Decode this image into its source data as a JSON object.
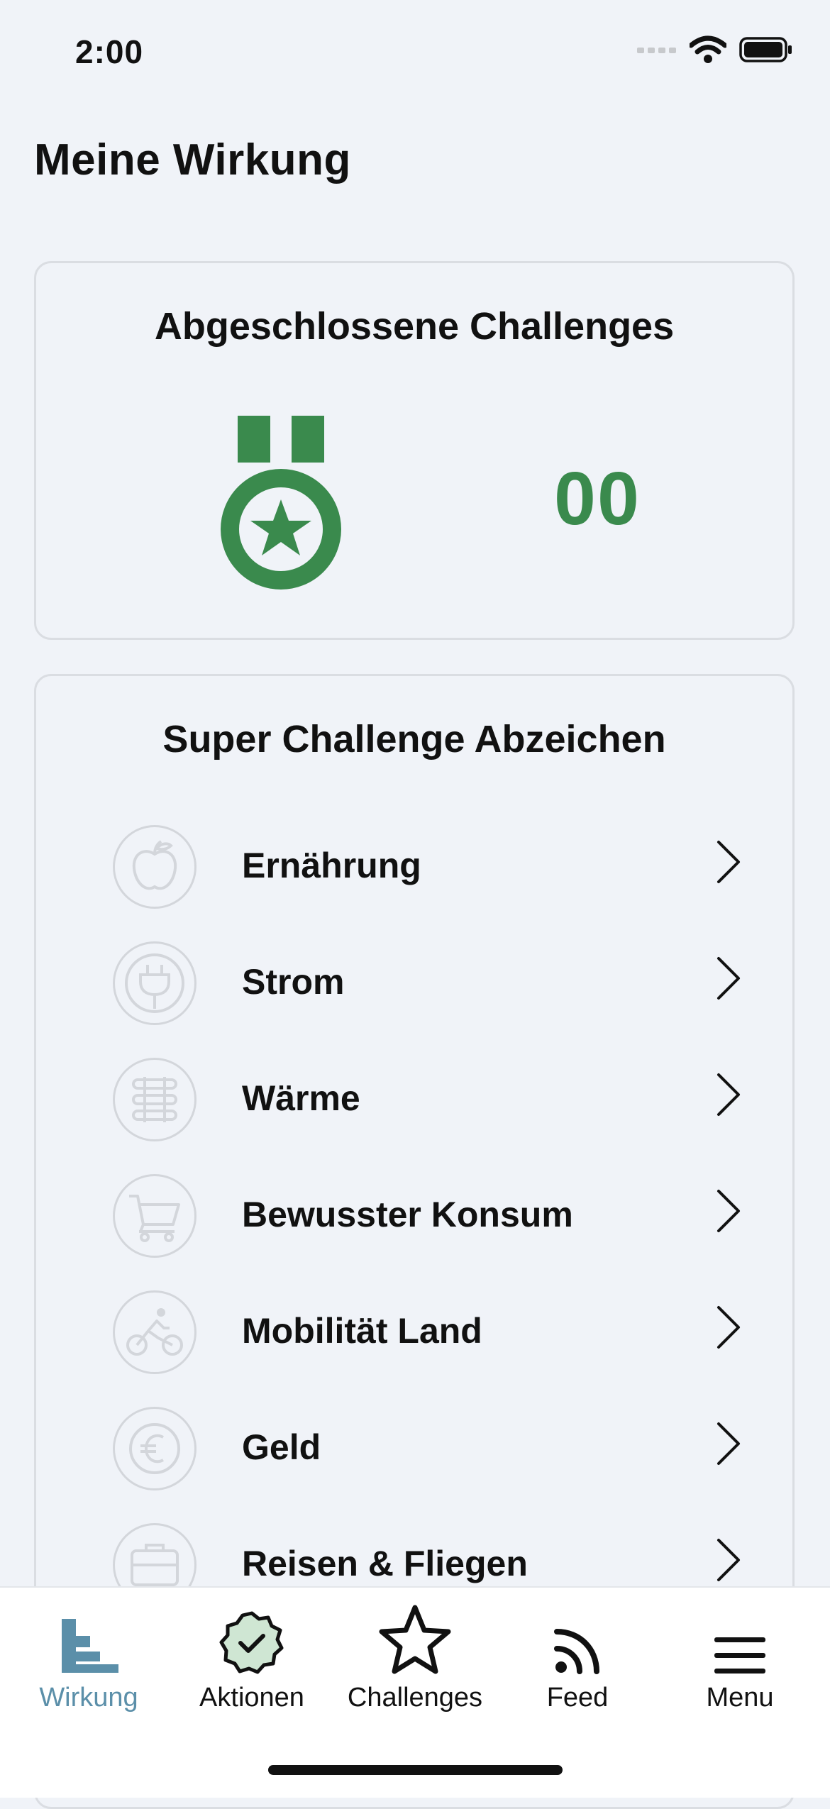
{
  "status_bar": {
    "time": "2:00"
  },
  "page": {
    "title": "Meine Wirkung"
  },
  "completed_card": {
    "heading": "Abgeschlossene Challenges",
    "count": "00",
    "icon": "medal-star-icon",
    "accent_color": "#3a8a4d"
  },
  "badges_card": {
    "heading": "Super Challenge Abzeichen",
    "items": [
      {
        "label": "Ernährung",
        "icon": "apple-icon"
      },
      {
        "label": "Strom",
        "icon": "plug-icon"
      },
      {
        "label": "Wärme",
        "icon": "radiator-icon"
      },
      {
        "label": "Bewusster Konsum",
        "icon": "shopping-cart-icon"
      },
      {
        "label": "Mobilität Land",
        "icon": "cyclist-icon"
      },
      {
        "label": "Geld",
        "icon": "euro-coin-icon"
      },
      {
        "label": "Reisen & Fliegen",
        "icon": "suitcase-icon"
      }
    ]
  },
  "tab_bar": {
    "active_color": "#5b8fa9",
    "tabs": [
      {
        "label": "Wirkung",
        "icon": "impact-chart-icon",
        "active": true
      },
      {
        "label": "Aktionen",
        "icon": "check-badge-icon",
        "active": false
      },
      {
        "label": "Challenges",
        "icon": "star-icon",
        "active": false
      },
      {
        "label": "Feed",
        "icon": "rss-feed-icon",
        "active": false
      },
      {
        "label": "Menu",
        "icon": "hamburger-menu-icon",
        "active": false
      }
    ]
  }
}
